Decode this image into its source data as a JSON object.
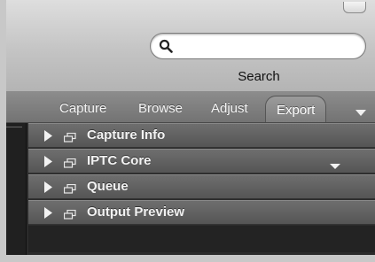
{
  "search": {
    "placeholder": "",
    "value": "",
    "label": "Search"
  },
  "tabs": [
    {
      "label": "Capture",
      "active": false
    },
    {
      "label": "Browse",
      "active": false
    },
    {
      "label": "Adjust",
      "active": false
    },
    {
      "label": "Export",
      "active": true
    }
  ],
  "icons": {
    "search": "magnifier-icon",
    "tabs_dropdown": "chevron-down-icon",
    "disclosure": "disclosure-triangle-icon",
    "panel": "window-icon",
    "panel_menu": "chevron-down-icon"
  },
  "panels": [
    {
      "label": "Capture Info",
      "expanded": false,
      "has_menu": false
    },
    {
      "label": "IPTC Core",
      "expanded": false,
      "has_menu": true
    },
    {
      "label": "Queue",
      "expanded": false,
      "has_menu": false
    },
    {
      "label": "Output Preview",
      "expanded": false,
      "has_menu": false
    }
  ],
  "colors": {
    "toolbar": "#c4c4c4",
    "tabbar": "#7e7e7e",
    "panel_header": "#606060",
    "panel_text": "#f2f2f2",
    "content_bg": "#232323"
  }
}
